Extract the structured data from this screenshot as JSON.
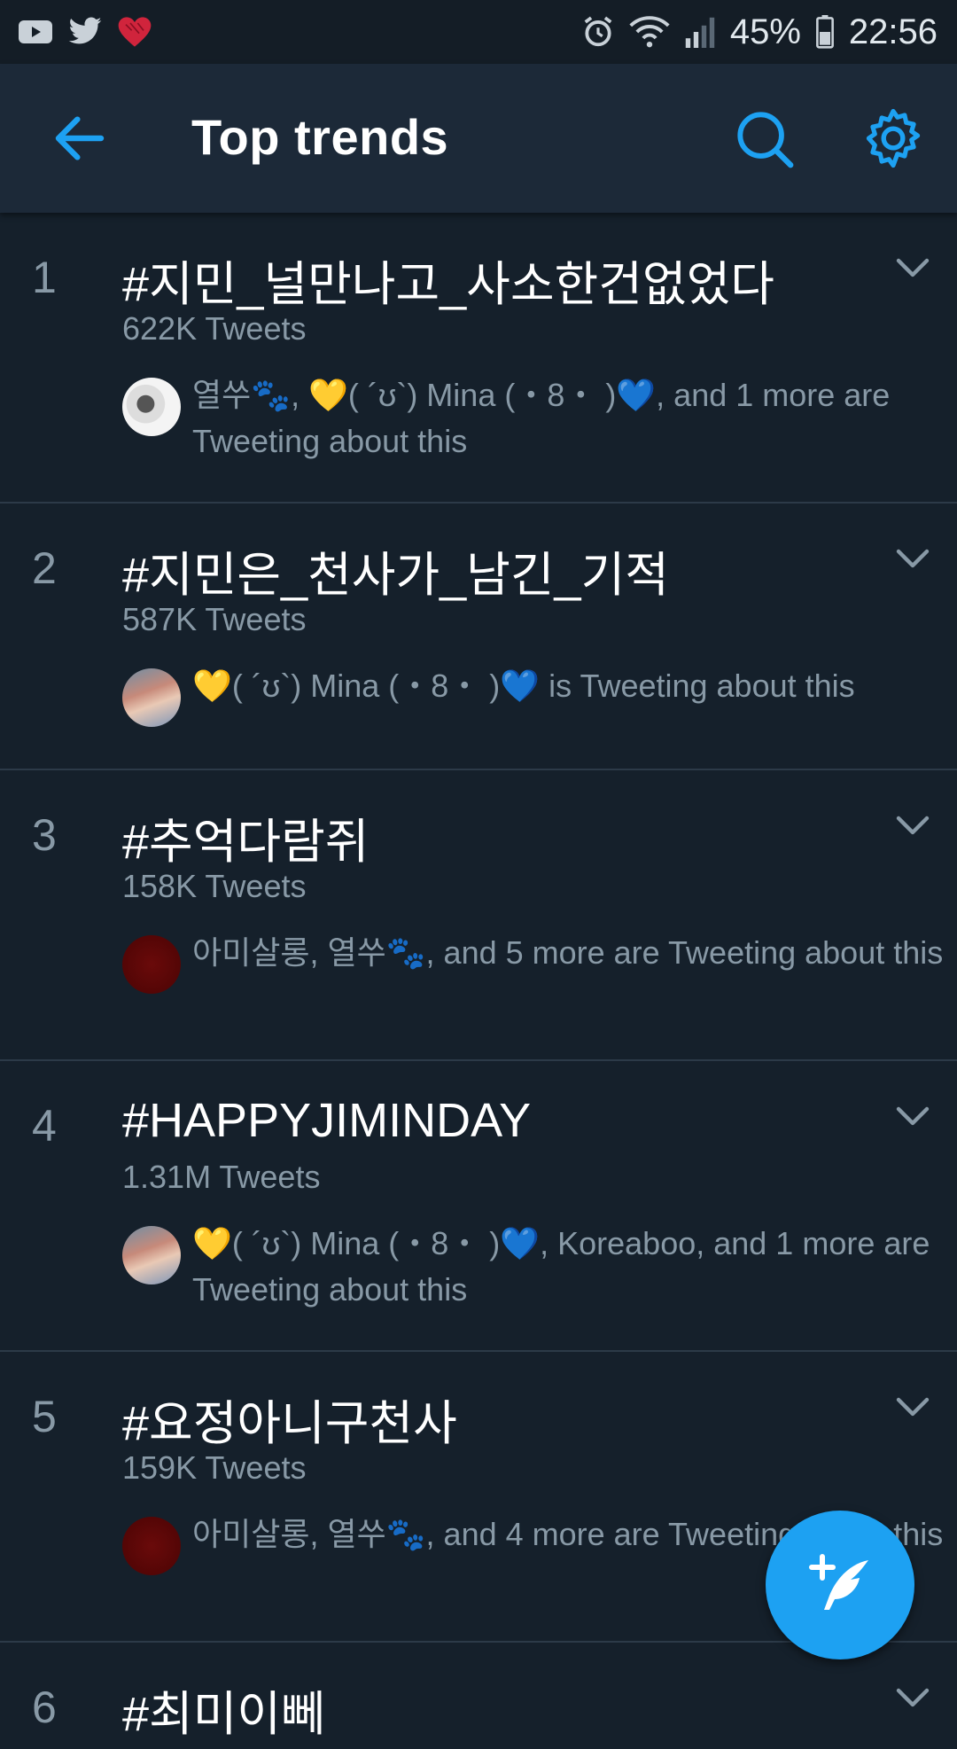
{
  "status_bar": {
    "battery": "45%",
    "time": "22:56",
    "left_icons": [
      "youtube-icon",
      "twitter-icon",
      "heart-icon"
    ],
    "right_icons": [
      "alarm-icon",
      "wifi-icon",
      "signal-icon",
      "battery-icon"
    ]
  },
  "header": {
    "title": "Top trends",
    "icons": [
      "back-arrow-icon",
      "search-icon",
      "settings-gear-icon"
    ],
    "accent_color": "#1da1f2"
  },
  "trends": [
    {
      "rank": "1",
      "name": "#지민_널만나고_사소한건없었다",
      "count": "622K Tweets",
      "social": "열쑤🐾, 💛( ´ʊ`) Mina (・8・ )💙, and 1 more are Tweeting about this"
    },
    {
      "rank": "2",
      "name": "#지민은_천사가_남긴_기적",
      "count": "587K Tweets",
      "social": "💛( ´ʊ`) Mina (・8・ )💙 is Tweeting about this"
    },
    {
      "rank": "3",
      "name": "#추억다람쥐",
      "count": "158K Tweets",
      "social": "아미살롱, 열쑤🐾, and 5 more are Tweeting about this"
    },
    {
      "rank": "4",
      "name": "#HAPPYJIMINDAY",
      "count": "1.31M Tweets",
      "social": "💛( ´ʊ`) Mina (・8・ )💙, Koreaboo, and 1 more are Tweeting about this"
    },
    {
      "rank": "5",
      "name": "#요정아니구천사",
      "count": "159K Tweets",
      "social": "아미살롱, 열쑤🐾, and 4 more are Tweeting about this"
    },
    {
      "rank": "6",
      "name": "#최미이뻬",
      "count": "",
      "social": ""
    }
  ],
  "fab": {
    "icon": "compose-tweet-icon"
  },
  "colors": {
    "background": "#15202b",
    "header_bg": "#1c2938",
    "secondary_text": "#8899a6",
    "divider": "#2c3a48",
    "accent": "#1da1f2"
  }
}
